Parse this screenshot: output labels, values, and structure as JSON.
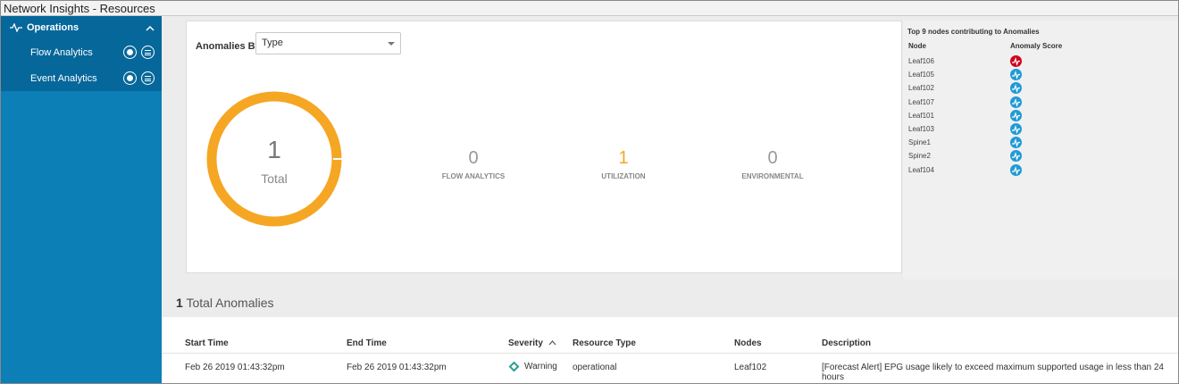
{
  "window": {
    "title": "Network Insights - Resources"
  },
  "sidebar": {
    "section": {
      "label": "Operations",
      "icon": "pulse-icon",
      "chevron": "chevron-up-icon"
    },
    "items": [
      {
        "label": "Flow Analytics"
      },
      {
        "label": "Event Analytics"
      }
    ]
  },
  "filter": {
    "label": "Anomalies By:",
    "selected": "Type"
  },
  "summary": {
    "total_value": "1",
    "total_label": "Total",
    "stats": [
      {
        "value": "0",
        "label": "FLOW ANALYTICS"
      },
      {
        "value": "1",
        "label": "UTILIZATION"
      },
      {
        "value": "0",
        "label": "ENVIRONMENTAL"
      }
    ]
  },
  "top_nodes": {
    "title": "Top 9 nodes contributing to Anomalies",
    "col_node": "Node",
    "col_score": "Anomaly Score",
    "rows": [
      {
        "node": "Leaf106",
        "severity": "critical"
      },
      {
        "node": "Leaf105",
        "severity": "healthy"
      },
      {
        "node": "Leaf102",
        "severity": "healthy"
      },
      {
        "node": "Leaf107",
        "severity": "healthy"
      },
      {
        "node": "Leaf101",
        "severity": "healthy"
      },
      {
        "node": "Leaf103",
        "severity": "healthy"
      },
      {
        "node": "Spine1",
        "severity": "healthy"
      },
      {
        "node": "Spine2",
        "severity": "healthy"
      },
      {
        "node": "Leaf104",
        "severity": "healthy"
      }
    ]
  },
  "anomalies": {
    "count": "1",
    "heading": "Total Anomalies",
    "columns": [
      "Start Time",
      "End Time",
      "Severity",
      "Resource Type",
      "Nodes",
      "Description"
    ],
    "rows": [
      {
        "start": "Feb 26 2019 01:43:32pm",
        "end": "Feb 26 2019 01:43:32pm",
        "severity": "Warning",
        "resource_type": "operational",
        "nodes": "Leaf102",
        "description": "[Forecast Alert] EPG usage likely to exceed maximum supported usage in less than 24 hours"
      }
    ]
  },
  "colors": {
    "sidebar": "#0b7fb6",
    "sidebar_active": "#06679a",
    "donut": "#f5a623",
    "critical": "#d0021b",
    "healthy": "#1f9ad6",
    "warning": "#2a9d8f"
  }
}
